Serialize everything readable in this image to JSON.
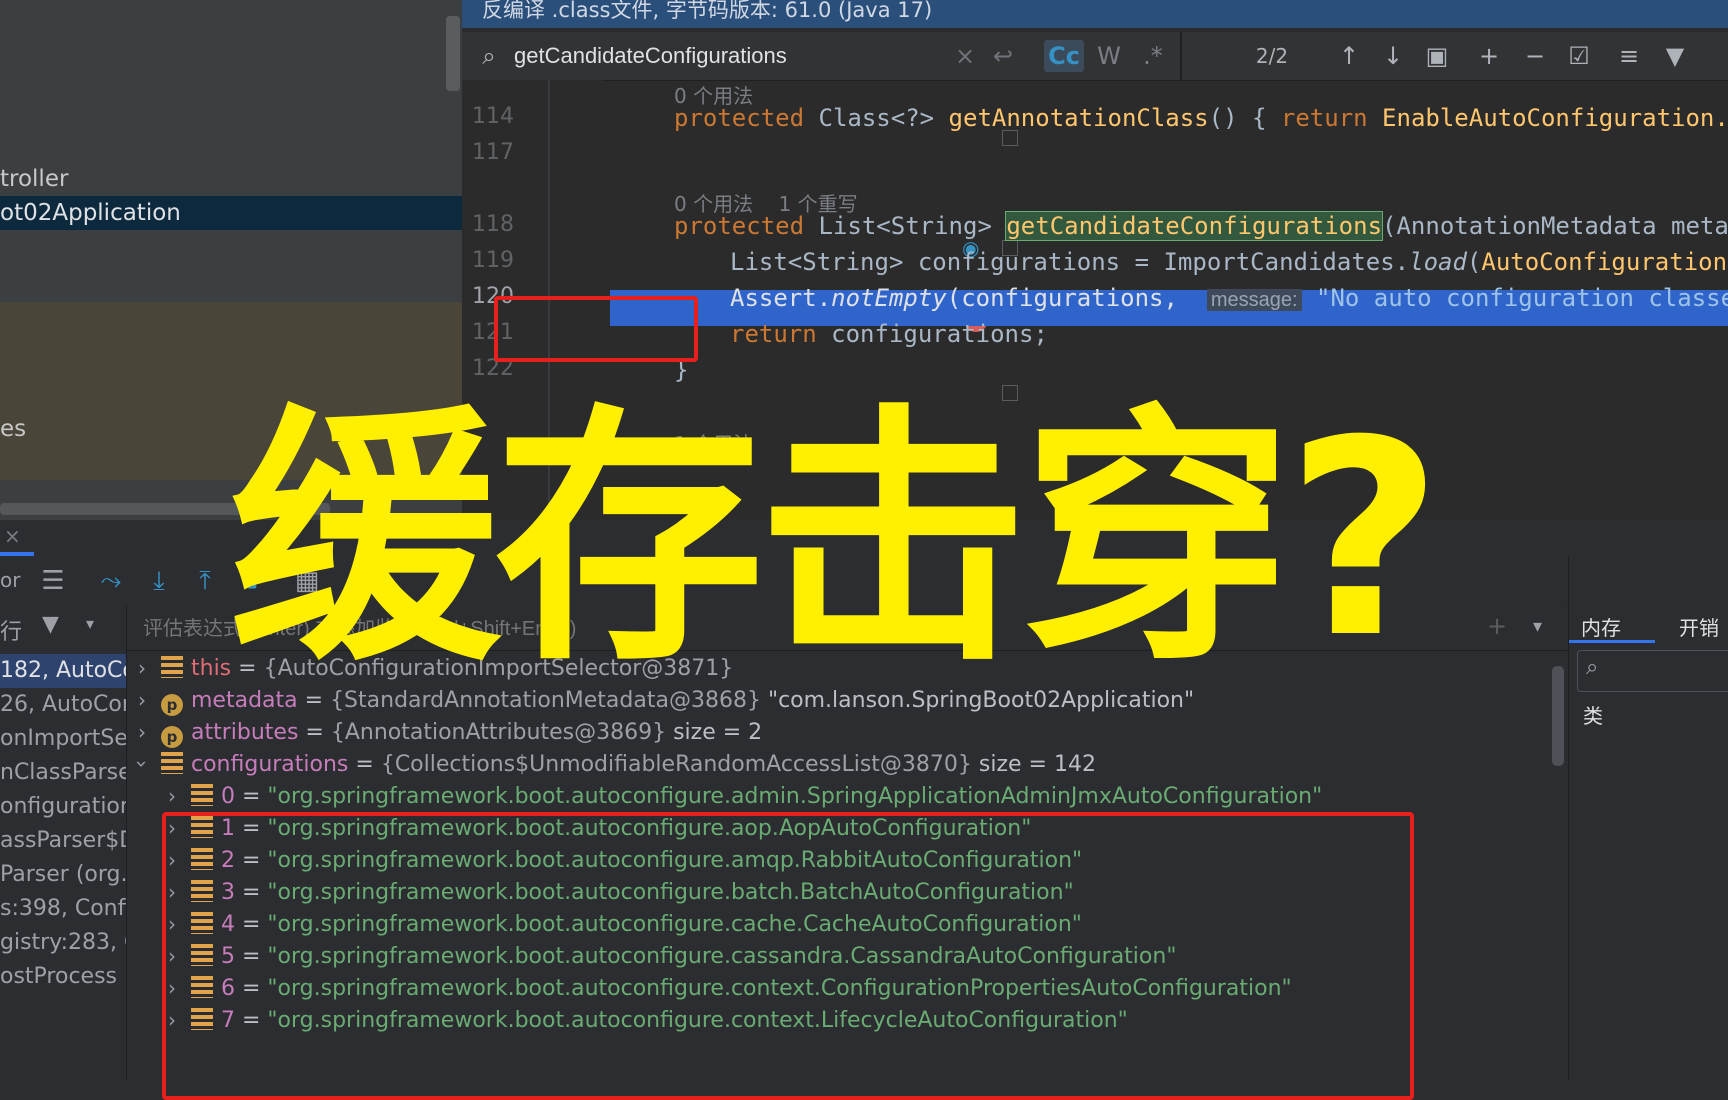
{
  "left_panel": {
    "items": [
      "troller",
      "ot02Application",
      "es"
    ]
  },
  "editor": {
    "banner": "反编译 .class文件, 字节码版本: 61.0 (Java 17)",
    "search": {
      "query": "getCandidateConfigurations",
      "match_case": "Cc",
      "words": "W",
      "regex": ".*",
      "count": "2/2"
    },
    "hints": {
      "h1": "0 个用法",
      "h2": "0 个用法    1 个重写",
      "h3": "1 个用法"
    },
    "lines": {
      "l114": "114",
      "l117": "117",
      "l118": "118",
      "l119": "119",
      "l120": "120",
      "l121": "121",
      "l122": "122"
    },
    "code": {
      "c114_kw": "protected",
      "c114_type": " Class<?> ",
      "c114_fn": "getAnnotationClass",
      "c114_rest": "() { ",
      "c114_ret": "return",
      "c114_cls": " EnableAutoConfiguration.cl",
      "c118_kw": "protected",
      "c118_type": " List<String> ",
      "c118_fn": "getCandidateConfigurations",
      "c118_rest": "(AnnotationMetadata metada",
      "c119_a": "List<String> configurations = ImportCandidates.",
      "c119_load": "load",
      "c119_b": "(",
      "c119_cls": "AutoConfiguration",
      "c119_c": ".",
      "c120_a": "Assert.",
      "c120_fn": "notEmpty",
      "c120_b": "(configurations,  ",
      "c120_label": "message:",
      "c120_str": " \"No auto configuration classes",
      "c121_ret": "return",
      "c121_rest": " configurations;",
      "c122": "}"
    }
  },
  "debug": {
    "left_label": "or",
    "frames_label": "行",
    "frames": [
      "182, AutoCor",
      "26, AutoCon",
      "onImportSel",
      "nClassParser",
      "onfigurationC",
      "assParser$De",
      "Parser (org.s",
      "s:398, Config",
      "gistry:283, C",
      "ostProcess"
    ],
    "eval_placeholder": "评估表达式 (Enter) 或添加监视 (Ctrl+Shift+Enter)",
    "right_tabs": [
      "内存",
      "开销"
    ],
    "right_label": "类",
    "vars": [
      {
        "name": "this",
        "value": "{AutoConfigurationImportSelector@3871}",
        "extra": ""
      },
      {
        "name": "metadata",
        "value": "{StandardAnnotationMetadata@3868}",
        "extra": " \"com.lanson.SpringBoot02Application\""
      },
      {
        "name": "attributes",
        "value": "{AnnotationAttributes@3869}",
        "extra": "  size = 2"
      },
      {
        "name": "configurations",
        "value": "{Collections$UnmodifiableRandomAccessList@3870}",
        "extra": "  size = 142"
      }
    ],
    "items": [
      {
        "idx": "0",
        "value": "\"org.springframework.boot.autoconfigure.admin.SpringApplicationAdminJmxAutoConfiguration\""
      },
      {
        "idx": "1",
        "value": "\"org.springframework.boot.autoconfigure.aop.AopAutoConfiguration\""
      },
      {
        "idx": "2",
        "value": "\"org.springframework.boot.autoconfigure.amqp.RabbitAutoConfiguration\""
      },
      {
        "idx": "3",
        "value": "\"org.springframework.boot.autoconfigure.batch.BatchAutoConfiguration\""
      },
      {
        "idx": "4",
        "value": "\"org.springframework.boot.autoconfigure.cache.CacheAutoConfiguration\""
      },
      {
        "idx": "5",
        "value": "\"org.springframework.boot.autoconfigure.cassandra.CassandraAutoConfiguration\""
      },
      {
        "idx": "6",
        "value": "\"org.springframework.boot.autoconfigure.context.ConfigurationPropertiesAutoConfiguration\""
      },
      {
        "idx": "7",
        "value": "\"org.springframework.boot.autoconfigure.context.LifecycleAutoConfiguration\""
      }
    ]
  },
  "overlay": {
    "title": "缓存击穿?"
  },
  "colors": {
    "overlay": "#ffef00",
    "highlight": "#e8201c",
    "selection_line": "#2f65ca"
  }
}
